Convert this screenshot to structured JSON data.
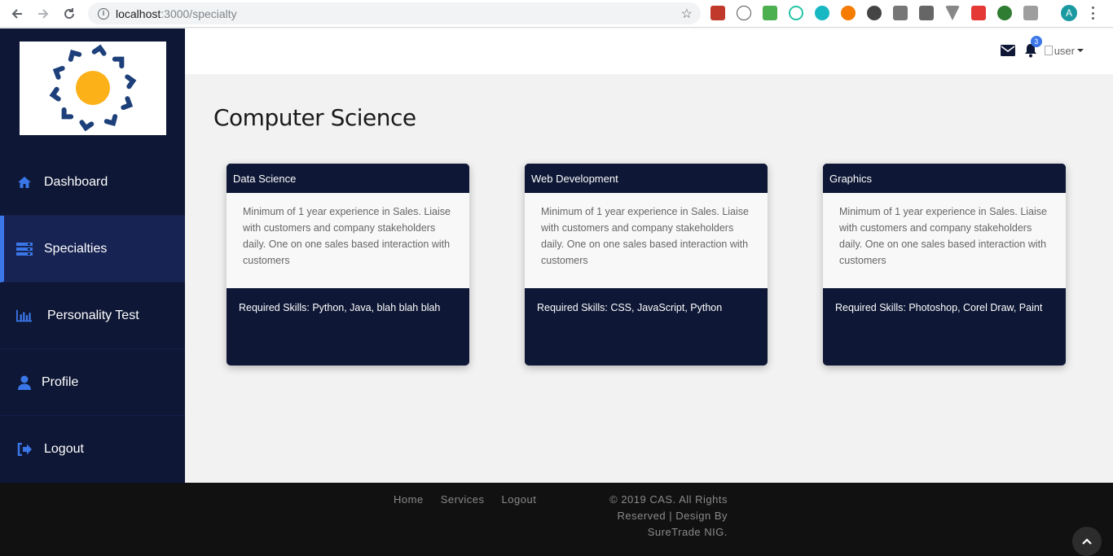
{
  "browser": {
    "url_host": "localhost",
    "url_path": ":3000/specialty",
    "avatar_letter": "A"
  },
  "sidebar": {
    "items": [
      {
        "label": "Dashboard",
        "icon": "home-icon"
      },
      {
        "label": "Specialties",
        "icon": "server-icon",
        "active": true
      },
      {
        "label": "Personality Test",
        "icon": "bar-chart-icon"
      },
      {
        "label": "Profile",
        "icon": "user-icon"
      },
      {
        "label": "Logout",
        "icon": "sign-out-icon"
      }
    ]
  },
  "topbar": {
    "notification_count": "3",
    "user_alt": "user"
  },
  "main": {
    "title": "Computer Science",
    "cards": [
      {
        "title": "Data Science",
        "description": "Minimum of 1 year experience in Sales. Liaise with customers and company stakeholders daily. One on one sales based interaction with customers",
        "skills": "Required Skills: Python, Java, blah blah blah"
      },
      {
        "title": "Web Development",
        "description": "Minimum of 1 year experience in Sales. Liaise with customers and company stakeholders daily. One on one sales based interaction with customers",
        "skills": "Required Skills: CSS, JavaScript, Python"
      },
      {
        "title": "Graphics",
        "description": "Minimum of 1 year experience in Sales. Liaise with customers and company stakeholders daily. One on one sales based interaction with customers",
        "skills": "Required Skills: Photoshop, Corel Draw, Paint"
      }
    ]
  },
  "footer": {
    "links": [
      "Home",
      "Services",
      "Logout"
    ],
    "copyright": "© 2019 CAS. All Rights Reserved | Design By SureTrade NIG."
  },
  "colors": {
    "sidebar_bg": "#0e1735",
    "accent": "#3a76e8",
    "footer_bg": "#111111",
    "logo_yellow": "#fbb117",
    "logo_blue": "#1d3f7a"
  }
}
